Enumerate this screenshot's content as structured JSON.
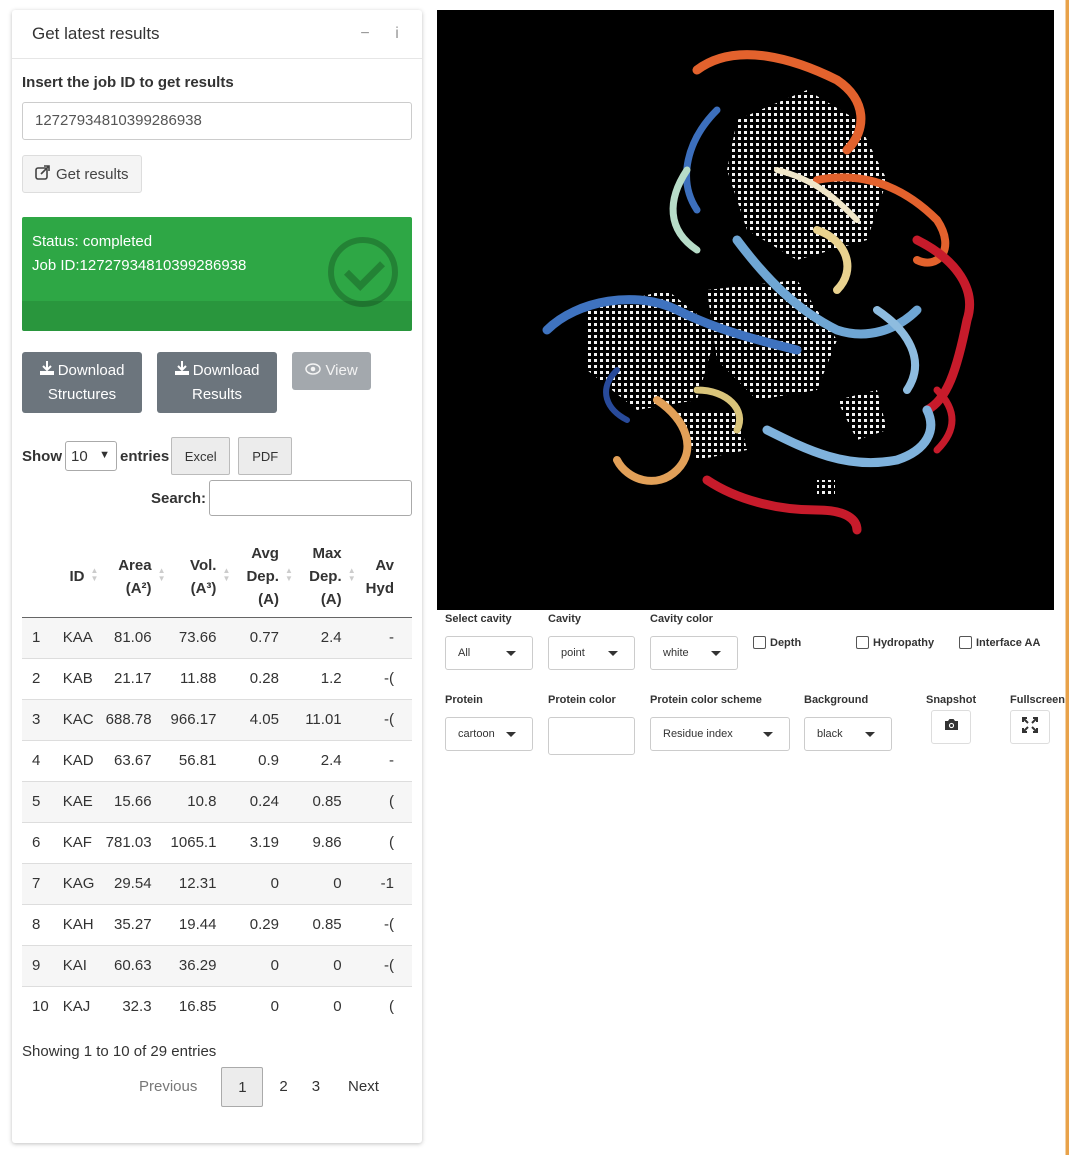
{
  "card": {
    "title": "Get latest results",
    "minimize_icon": "minus-icon",
    "info_icon": "info-icon",
    "job_label": "Insert the job ID to get results",
    "job_input_value": "12727934810399286938",
    "get_results_label": "Get results"
  },
  "status": {
    "line1": "Status: completed",
    "line2": "Job ID:12727934810399286938",
    "color": "#2ea745"
  },
  "actions": {
    "download_structures_line1": "Download",
    "download_structures_line2": "Structures",
    "download_results_line1": "Download",
    "download_results_line2": "Results",
    "view_label": "View"
  },
  "datatable": {
    "show_label": "Show",
    "entries_label": "entries",
    "page_length": "10",
    "excel_label": "Excel",
    "pdf_label": "PDF",
    "search_label": "Search:",
    "columns": [
      {
        "l1": "",
        "l2": "",
        "l3": ""
      },
      {
        "l1": "ID",
        "l2": "",
        "l3": ""
      },
      {
        "l1": "Area",
        "l2": "(A²)",
        "l3": ""
      },
      {
        "l1": "Vol.",
        "l2": "(A³)",
        "l3": ""
      },
      {
        "l1": "Avg",
        "l2": "Dep.",
        "l3": "(A)"
      },
      {
        "l1": "Max",
        "l2": "Dep.",
        "l3": "(A)"
      },
      {
        "l1": "Av",
        "l2": "Hyd",
        "l3": ""
      }
    ],
    "rows": [
      [
        "1",
        "KAA",
        "81.06",
        "73.66",
        "0.77",
        "2.4",
        "-"
      ],
      [
        "2",
        "KAB",
        "21.17",
        "11.88",
        "0.28",
        "1.2",
        "-("
      ],
      [
        "3",
        "KAC",
        "688.78",
        "966.17",
        "4.05",
        "11.01",
        "-("
      ],
      [
        "4",
        "KAD",
        "63.67",
        "56.81",
        "0.9",
        "2.4",
        "-"
      ],
      [
        "5",
        "KAE",
        "15.66",
        "10.8",
        "0.24",
        "0.85",
        "("
      ],
      [
        "6",
        "KAF",
        "781.03",
        "1065.1",
        "3.19",
        "9.86",
        "("
      ],
      [
        "7",
        "KAG",
        "29.54",
        "12.31",
        "0",
        "0",
        "-1"
      ],
      [
        "8",
        "KAH",
        "35.27",
        "19.44",
        "0.29",
        "0.85",
        "-("
      ],
      [
        "9",
        "KAI",
        "60.63",
        "36.29",
        "0",
        "0",
        "-("
      ],
      [
        "10",
        "KAJ",
        "32.3",
        "16.85",
        "0",
        "0",
        "("
      ]
    ],
    "info": "Showing 1 to 10 of 29 entries",
    "prev_label": "Previous",
    "pages": [
      "1",
      "2",
      "3"
    ],
    "next_label": "Next"
  },
  "viewer": {
    "background": "#000000"
  },
  "controls": {
    "select_cavity_label": "Select cavity",
    "select_cavity_value": "All",
    "cavity_label": "Cavity",
    "cavity_value": "point",
    "cavity_color_label": "Cavity color",
    "cavity_color_value": "white",
    "depth_label": "Depth",
    "hydropathy_label": "Hydropathy",
    "interface_label": "Interface AA",
    "protein_label": "Protein",
    "protein_value": "cartoon",
    "protein_color_label": "Protein color",
    "protein_color_value": "",
    "scheme_label": "Protein color scheme",
    "scheme_value": "Residue index",
    "background_label": "Background",
    "background_value": "black",
    "snapshot_label": "Snapshot",
    "fullscreen_label": "Fullscreen",
    "snapshot_icon": "camera-icon",
    "fullscreen_icon": "expand-icon"
  }
}
